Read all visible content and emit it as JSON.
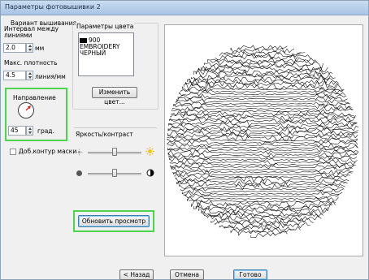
{
  "window": {
    "title": "Параметры фотовышивки 2"
  },
  "stitch": {
    "group_label": "Вариант вышивания",
    "spacing_label": "Интервал между линиями",
    "spacing_value": "2.0",
    "spacing_unit": "мм",
    "density_label": "Макс. плотность",
    "density_value": "4.5",
    "density_unit": "линия/мм"
  },
  "direction": {
    "label": "Направление",
    "angle_value": "45",
    "angle_unit": "град.",
    "angle_deg": 45
  },
  "mask": {
    "label": "Доб.контур маски",
    "checked": false
  },
  "color": {
    "group_label": "Параметры цвета",
    "swatch": "#000000",
    "code": "900",
    "brand": "EMBROIDERY",
    "name": "ЧЕРНЫЙ",
    "change_button": "Изменить цвет..."
  },
  "adjust": {
    "label": "Яркость/контраст",
    "brightness_level": 0.5,
    "contrast_level": 0.5
  },
  "preview_button": "Обновить просмотр",
  "footer": {
    "back": "< Назад",
    "cancel": "Отмена",
    "finish": "Готово"
  }
}
